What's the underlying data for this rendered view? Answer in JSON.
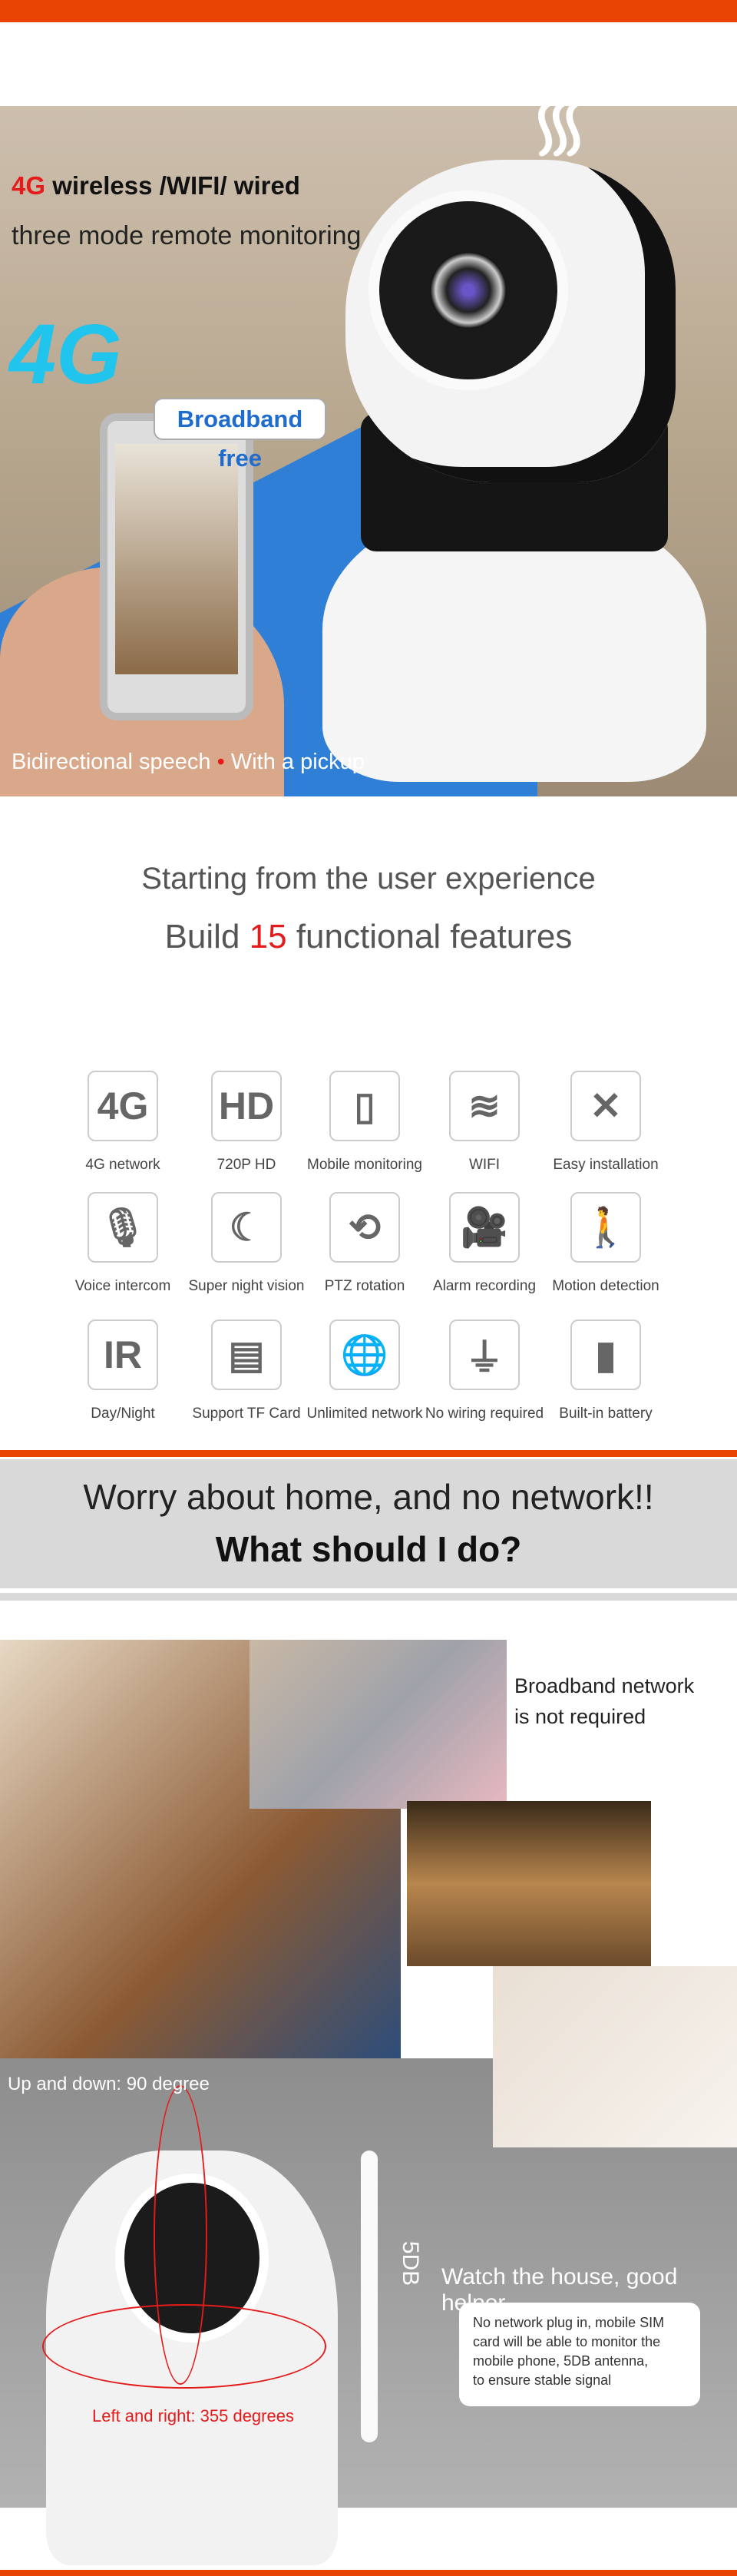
{
  "colors": {
    "accent": "#ea4404",
    "red": "#e41b1b",
    "blue": "#1e6ccd",
    "band": "#d9d9d9"
  },
  "hero": {
    "headline_red": "4G",
    "headline_rest": " wireless /WIFI/ wired",
    "subline": "three mode remote monitoring",
    "logo": "4G",
    "broadband_badge": "Broadband free",
    "caption_left": "Bidirectional speech",
    "caption_sep": "•",
    "caption_right": "With a pickup"
  },
  "features_intro": {
    "line1": "Starting from the user experience",
    "line2_pre": "Build ",
    "line2_num": "15",
    "line2_post": " functional features"
  },
  "features": [
    {
      "label": "4G network",
      "icon": "4g-icon",
      "glyph": "4G"
    },
    {
      "label": "720P HD",
      "icon": "hd-icon",
      "glyph": "HD"
    },
    {
      "label": "Mobile monitoring",
      "icon": "phone-icon",
      "glyph": "▯"
    },
    {
      "label": "WIFI",
      "icon": "wifi-icon",
      "glyph": "≋"
    },
    {
      "label": "Easy installation",
      "icon": "tools-icon",
      "glyph": "✕"
    },
    {
      "label": "Voice intercom",
      "icon": "microphone-icon",
      "glyph": "🎙"
    },
    {
      "label": "Super night vision",
      "icon": "moon-stars-icon",
      "glyph": "☾"
    },
    {
      "label": "PTZ rotation",
      "icon": "rotation-icon",
      "glyph": "⟲"
    },
    {
      "label": "Alarm recording",
      "icon": "video-camera-icon",
      "glyph": "🎥"
    },
    {
      "label": "Motion detection",
      "icon": "walking-person-icon",
      "glyph": "🚶"
    },
    {
      "label": "Day/Night",
      "icon": "ir-icon",
      "glyph": "IR"
    },
    {
      "label": "Support TF Card",
      "icon": "sd-card-icon",
      "glyph": "▤"
    },
    {
      "label": "Unlimited network",
      "icon": "globe-icon",
      "glyph": "🌐"
    },
    {
      "label": "No wiring required",
      "icon": "plug-icon",
      "glyph": "⏚"
    },
    {
      "label": "Built-in battery",
      "icon": "battery-icon",
      "glyph": "▮"
    }
  ],
  "worry": {
    "line1": "Worry about home, and no network!!",
    "line2": "What should I do?"
  },
  "collage": {
    "broadband_line1": "Broadband network",
    "broadband_line2": "is not required",
    "up_down": "Up and down:  90 degree",
    "left_right": "Left and right: 355 degrees",
    "antenna": "5DB",
    "helper_title": "Watch the house, good helper",
    "helper_lines": [
      "No network plug in, mobile SIM",
      "card will be able to monitor the",
      "mobile phone, 5DB antenna,",
      "to ensure stable signal"
    ]
  }
}
